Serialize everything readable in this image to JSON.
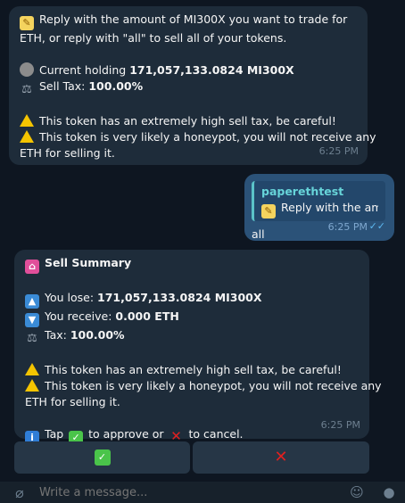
{
  "messages": {
    "m1": {
      "l1": "Reply with the amount of MI300X you want to trade for",
      "l2": "ETH, or reply with \"all\" to sell all of your tokens.",
      "holding_prefix": "Current holding ",
      "holding_value": "171,057,133.0824 MI300X",
      "tax_prefix": "Sell Tax: ",
      "tax_value": "100.00%",
      "warn1": "This token has an extremely high sell tax, be careful!",
      "warn2a": "This token is very likely a honeypot, you will not receive any",
      "warn2b": "ETH for selling it.",
      "time": "6:25 PM"
    },
    "m2": {
      "reply_name": "paperethtest",
      "reply_text": "Reply with the am...",
      "text": "all",
      "time": "6:25 PM"
    },
    "m3": {
      "title": "Sell Summary",
      "lose_prefix": "You lose: ",
      "lose_value": "171,057,133.0824 MI300X",
      "receive_prefix": "You receive: ",
      "receive_value": "0.000 ETH",
      "tax_prefix": "Tax: ",
      "tax_value": "100.00%",
      "warn1": "This token has an extremely high sell tax, be careful!",
      "warn2a": "This token is very likely a honeypot, you will not receive any",
      "warn2b": "ETH for selling it.",
      "tap_a": "Tap",
      "tap_b": "to approve or",
      "tap_c": "to cancel.",
      "time": "6:25 PM"
    }
  },
  "keyboard": {
    "approve": "✅",
    "cancel": "❌"
  },
  "composer": {
    "placeholder": "Write a message..."
  },
  "icons": {
    "memo": "memo-icon",
    "coin": "coin-icon",
    "scale": "scale-icon",
    "warn": "warning-icon",
    "bag": "shopping-bags-icon",
    "outbox": "outbox-tray-icon",
    "inbox": "inbox-tray-icon",
    "info": "info-icon",
    "check": "check-mark-icon",
    "cross": "cross-mark-icon"
  },
  "colors": {
    "background": "#0e1621",
    "incoming": "#1e2c3a",
    "outgoing": "#2b5278",
    "accent": "#5cb8f0"
  }
}
